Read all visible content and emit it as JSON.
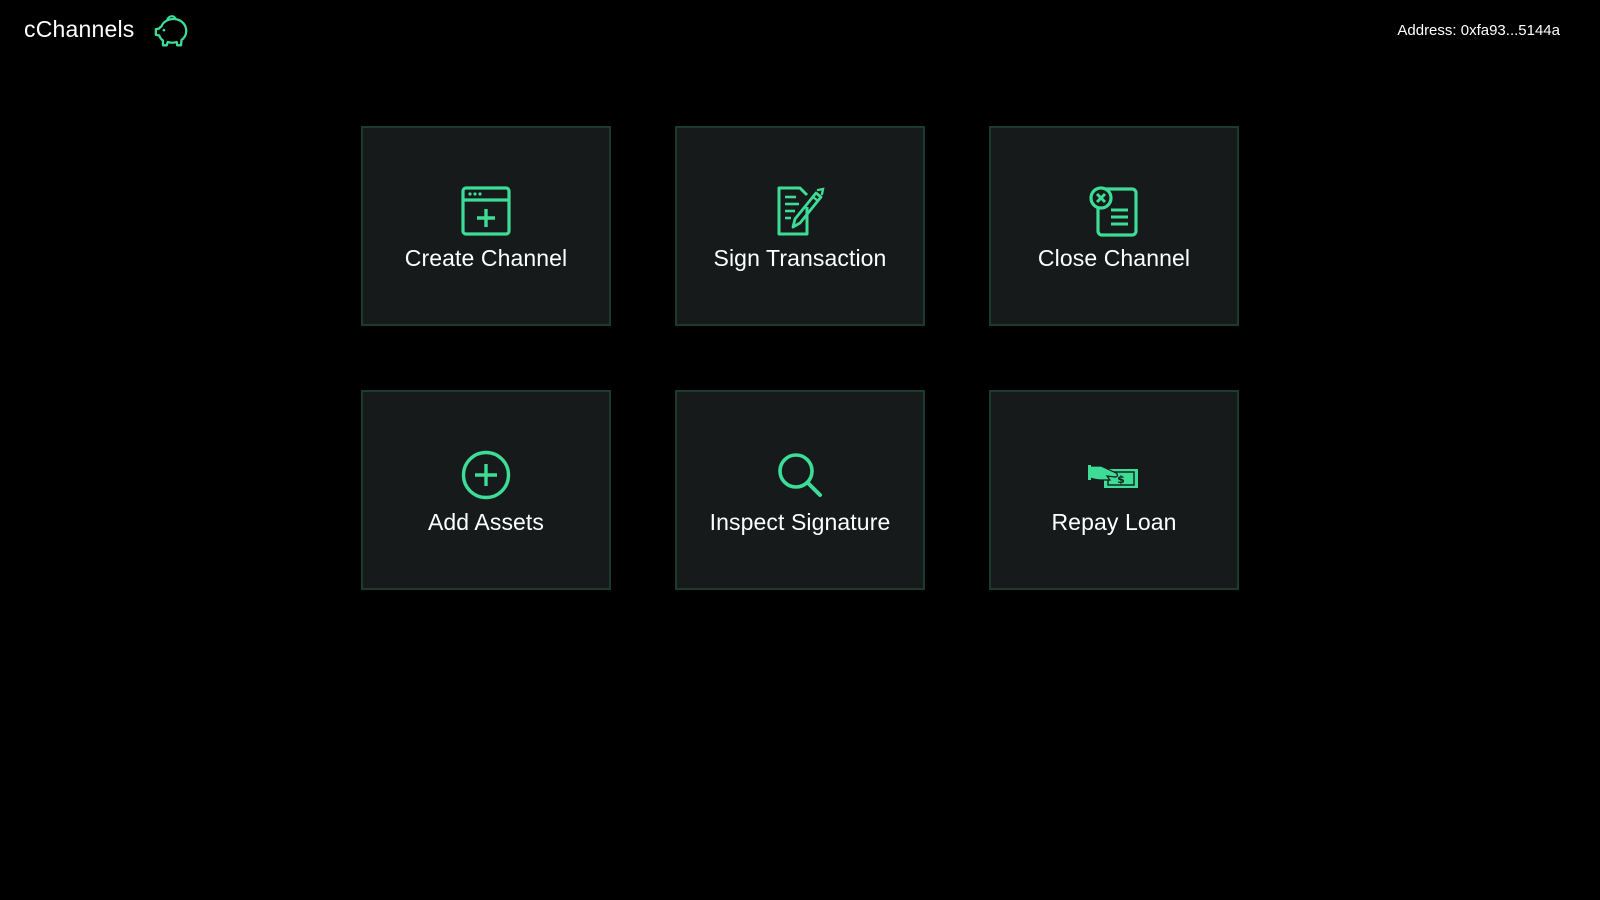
{
  "app": {
    "title": "cChannels",
    "logo_icon": "piggy-bank-icon",
    "address_label": "Address: 0xfa93...5144a"
  },
  "colors": {
    "accent": "#3ddc97",
    "tile_background": "#161a1a",
    "tile_border": "#1c3b2f",
    "page_background": "#000000",
    "text": "#ffffff"
  },
  "tiles": [
    {
      "label": "Create Channel",
      "icon": "window-plus-icon"
    },
    {
      "label": "Sign Transaction",
      "icon": "document-pen-icon"
    },
    {
      "label": "Close Channel",
      "icon": "document-close-icon"
    },
    {
      "label": "Add Assets",
      "icon": "plus-circle-icon"
    },
    {
      "label": "Inspect Signature",
      "icon": "magnifier-icon"
    },
    {
      "label": "Repay Loan",
      "icon": "hand-cash-icon"
    }
  ]
}
